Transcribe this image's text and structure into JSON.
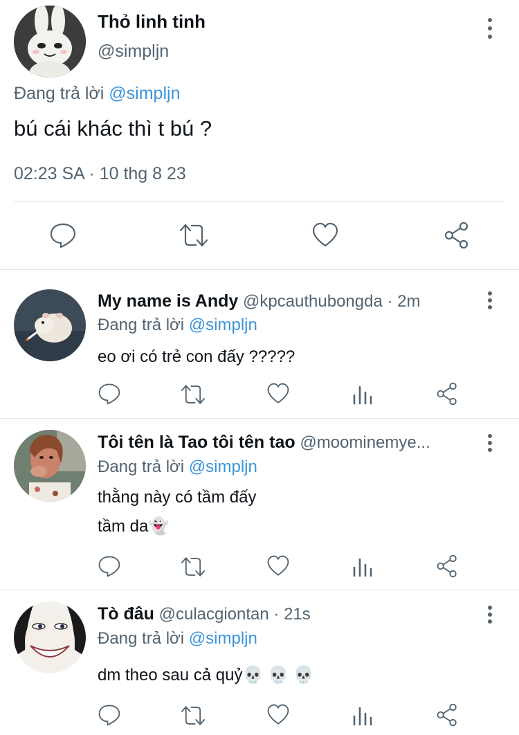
{
  "main_tweet": {
    "display_name": "Thỏ linh tinh",
    "handle": "@simpljn",
    "replying_prefix": "Đang trả lời",
    "replying_to": "@simpljn",
    "text": "bú cái khác thì t bú ?",
    "timestamp": "02:23 SA · 10 thg 8 23",
    "actions": [
      "reply-icon",
      "retweet-icon",
      "like-icon",
      "share-icon"
    ]
  },
  "replies": [
    {
      "display_name": "My name is Andy",
      "handle": "@kpcauthubongda",
      "time": "· 2m",
      "replying_prefix": "Đang trả lời",
      "replying_to": "@simpljn",
      "lines": [
        "eo ơi có trẻ con đấy ?????"
      ]
    },
    {
      "display_name": "Tôi tên là Tao tôi tên tao",
      "handle": "@moominemye...",
      "time": "",
      "replying_prefix": "Đang trả lời",
      "replying_to": "@simpljn",
      "lines": [
        "thằng này có tầm đấy",
        "tầm da👻"
      ]
    },
    {
      "display_name": "Tò đâu",
      "handle": "@culacgiontan",
      "time": "· 21s",
      "replying_prefix": "Đang trả lời",
      "replying_to": "@simpljn",
      "lines": [
        "dm theo sau cả quỷ💀 💀 💀"
      ]
    }
  ],
  "reply_actions": [
    "reply-icon",
    "retweet-icon",
    "like-icon",
    "views-icon",
    "share-icon"
  ],
  "colors": {
    "link": "#3b94d9",
    "muted": "#536471",
    "text": "#0f1419",
    "divider": "#e1e6ea"
  }
}
